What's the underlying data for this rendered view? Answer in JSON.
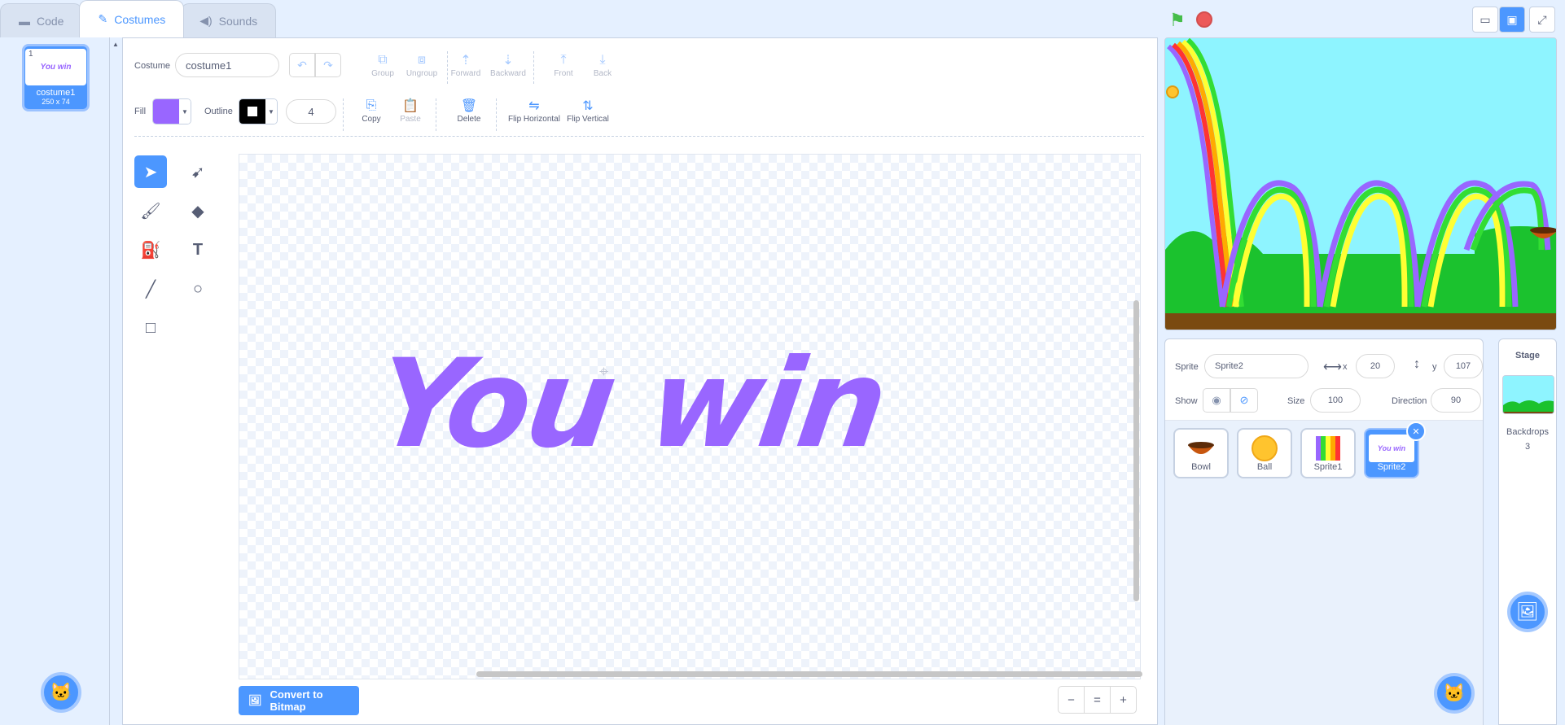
{
  "tabs": [
    {
      "label": "Code",
      "icon": "code-icon"
    },
    {
      "label": "Costumes",
      "icon": "brush-icon"
    },
    {
      "label": "Sounds",
      "icon": "speaker-icon"
    }
  ],
  "costume_list": {
    "items": [
      {
        "number": "1",
        "name": "costume1",
        "size": "250 x 74",
        "thumb_text": "You win"
      }
    ]
  },
  "editor": {
    "costume_label": "Costume",
    "costume_name": "costume1",
    "row1_buttons": [
      "Group",
      "Ungroup",
      "Forward",
      "Backward",
      "Front",
      "Back"
    ],
    "fill_label": "Fill",
    "outline_label": "Outline",
    "fill_color": "#9966ff",
    "outline_color": "#000000",
    "outline_width": "4",
    "row2_buttons": [
      "Copy",
      "Paste",
      "Delete",
      "Flip Horizontal",
      "Flip Vertical"
    ],
    "canvas_text": "You win",
    "convert_label": "Convert to Bitmap",
    "zoom_out": "−",
    "zoom_reset": "=",
    "zoom_in": "+"
  },
  "sprite_info": {
    "sprite_label": "Sprite",
    "sprite_name": "Sprite2",
    "x_label": "x",
    "x_value": "20",
    "y_label": "y",
    "y_value": "107",
    "show_label": "Show",
    "size_label": "Size",
    "size_value": "100",
    "direction_label": "Direction",
    "direction_value": "90"
  },
  "sprites": [
    {
      "name": "Bowl"
    },
    {
      "name": "Ball"
    },
    {
      "name": "Sprite1"
    },
    {
      "name": "Sprite2",
      "thumb_text": "You win"
    }
  ],
  "stage_panel": {
    "title": "Stage",
    "backdrops_label": "Backdrops",
    "backdrops_count": "3"
  },
  "colors": {
    "accent": "#4c97ff",
    "sprite_purple": "#9966ff",
    "flag_green": "#45bd4a",
    "stop_red": "#ec5959"
  }
}
